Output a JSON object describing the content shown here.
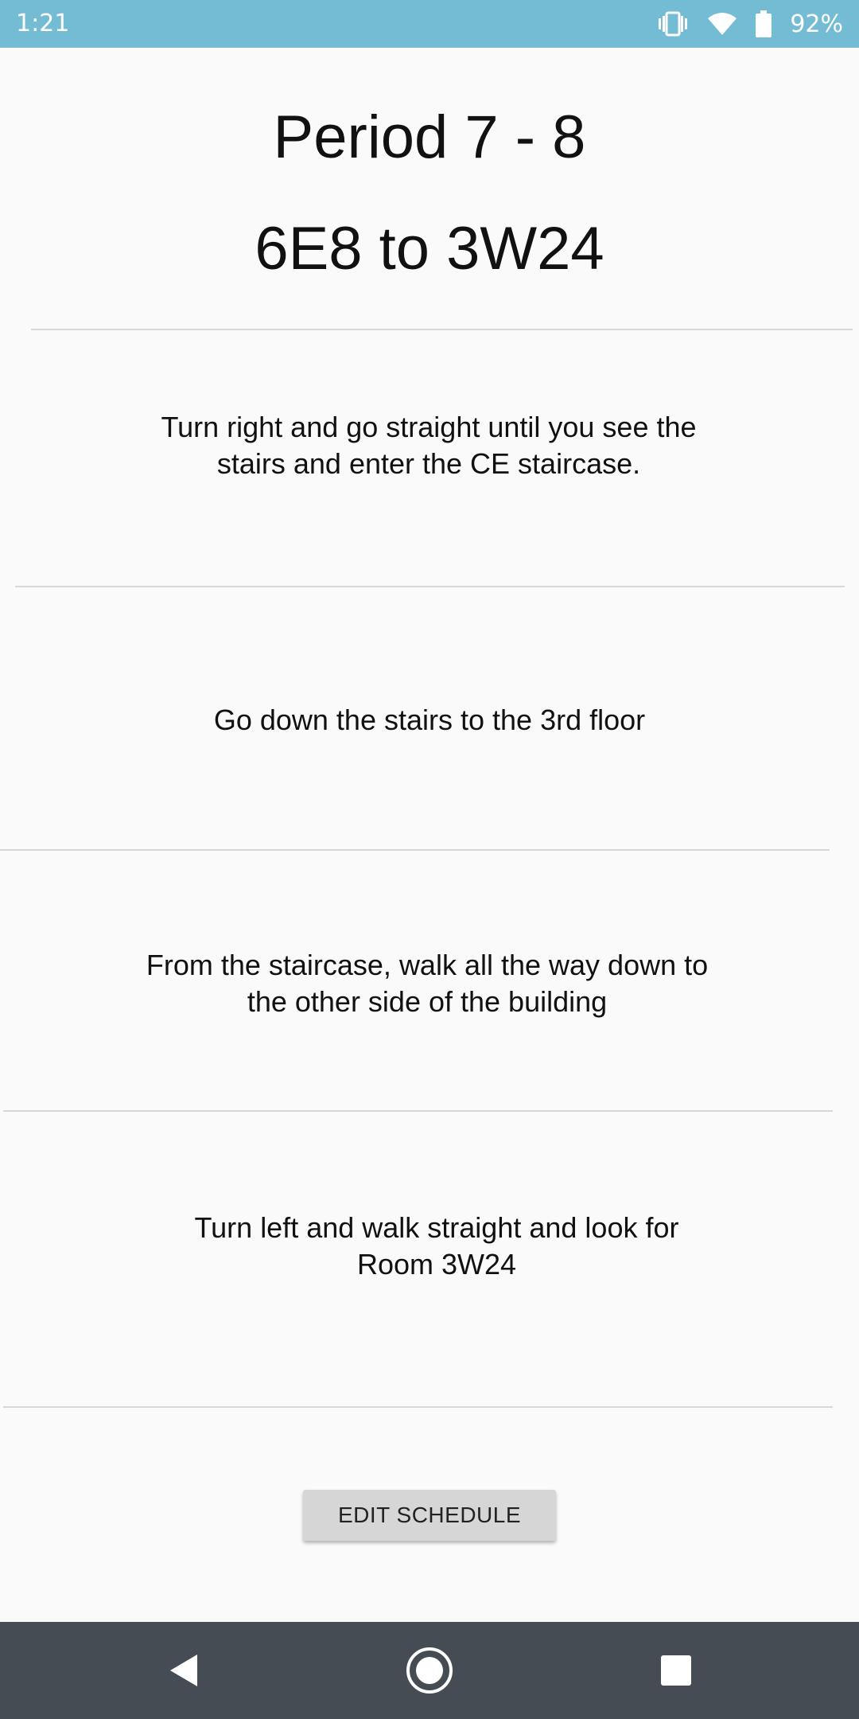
{
  "status_bar": {
    "time": "1:21",
    "battery_percent": "92%",
    "icons": [
      "vibrate-icon",
      "wifi-icon",
      "battery-icon"
    ]
  },
  "header": {
    "period": "Period 7 - 8",
    "route": "6E8 to 3W24"
  },
  "steps": [
    {
      "line1": "Turn right and go straight until you see the",
      "line2": "stairs and enter the CE staircase."
    },
    {
      "line1": "Go down the stairs to the 3rd floor",
      "line2": ""
    },
    {
      "line1": "From the staircase, walk all the way down to",
      "line2": "the other side of the building"
    },
    {
      "line1": "Turn left and walk straight and look for",
      "line2": "Room 3W24"
    }
  ],
  "actions": {
    "edit_schedule_label": "EDIT SCHEDULE"
  },
  "nav_bar": {
    "icons": [
      "back-icon",
      "home-icon",
      "recents-icon"
    ]
  },
  "colors": {
    "status_bar": "#73bcd4",
    "background": "#fafafa",
    "nav_bar": "#454c53",
    "button": "#d6d6d6",
    "divider": "#d8d8d8"
  }
}
